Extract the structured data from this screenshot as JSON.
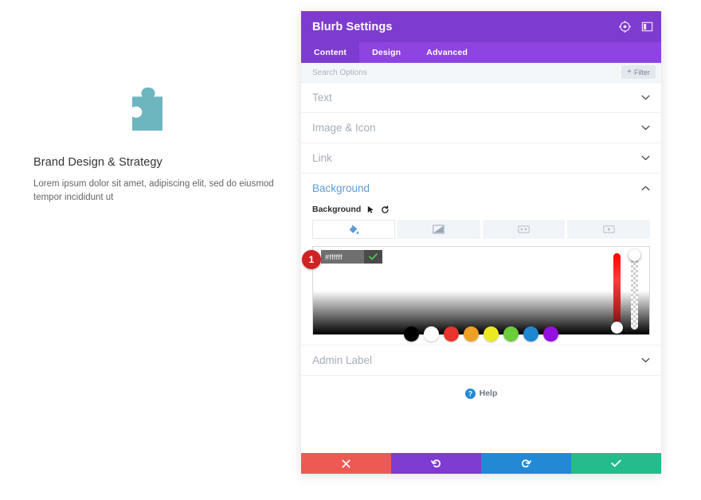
{
  "preview": {
    "icon": "puzzle-piece-icon",
    "icon_color": "#6eb6bf",
    "title": "Brand Design & Strategy",
    "body": "Lorem ipsum dolor sit amet, adipiscing elit, sed do eiusmod tempor incididunt ut"
  },
  "panel": {
    "title": "Blurb Settings",
    "header_icons": [
      {
        "name": "target-icon"
      },
      {
        "name": "layout-toggle-icon"
      }
    ],
    "tabs": [
      {
        "label": "Content",
        "active": true
      },
      {
        "label": "Design",
        "active": false
      },
      {
        "label": "Advanced",
        "active": false
      }
    ],
    "search": {
      "placeholder": "Search Options",
      "value": ""
    },
    "filter_button": {
      "plus": "+",
      "label": "Filter"
    },
    "sections": [
      {
        "label": "Text",
        "open": false
      },
      {
        "label": "Image & Icon",
        "open": false
      },
      {
        "label": "Link",
        "open": false
      },
      {
        "label": "Background",
        "open": true
      },
      {
        "label": "Admin Label",
        "open": false
      }
    ],
    "background": {
      "field_label": "Background",
      "field_icons": [
        {
          "name": "cursor-pointer-icon"
        },
        {
          "name": "reset-icon"
        }
      ],
      "type_tabs": [
        {
          "name": "background-color-tab",
          "icon": "paint-bucket-icon",
          "active": true
        },
        {
          "name": "background-gradient-tab",
          "icon": "gradient-icon",
          "active": false
        },
        {
          "name": "background-image-tab",
          "icon": "image-icon",
          "active": false
        },
        {
          "name": "background-video-tab",
          "icon": "video-icon",
          "active": false
        }
      ],
      "color_picker": {
        "badge": "1",
        "hex_value": "#ffffff",
        "hex_placeholder": "#ffffff",
        "confirm_icon": "check-icon",
        "hue_slider": {
          "name": "hue-slider",
          "handle_position": "bottom"
        },
        "alpha_slider": {
          "name": "alpha-slider",
          "handle_position": "top"
        },
        "swatches": [
          {
            "name": "swatch-black",
            "color": "#000000"
          },
          {
            "name": "swatch-white",
            "color": "#ffffff"
          },
          {
            "name": "swatch-red",
            "color": "#e8342c"
          },
          {
            "name": "swatch-orange",
            "color": "#eda023"
          },
          {
            "name": "swatch-yellow",
            "color": "#ece822"
          },
          {
            "name": "swatch-green",
            "color": "#6ccc3a"
          },
          {
            "name": "swatch-blue",
            "color": "#1f86d0"
          },
          {
            "name": "swatch-purple",
            "color": "#9410e0"
          }
        ]
      }
    },
    "help": {
      "icon": "help-circle-icon",
      "label": "Help"
    },
    "footer_buttons": [
      {
        "name": "cancel-button",
        "icon": "close-icon",
        "color": "#ed5a53"
      },
      {
        "name": "undo-button",
        "icon": "undo-icon",
        "color": "#7e3bd0"
      },
      {
        "name": "redo-button",
        "icon": "redo-icon",
        "color": "#2389d4"
      },
      {
        "name": "save-button",
        "icon": "check-icon",
        "color": "#24bc8c"
      }
    ]
  }
}
